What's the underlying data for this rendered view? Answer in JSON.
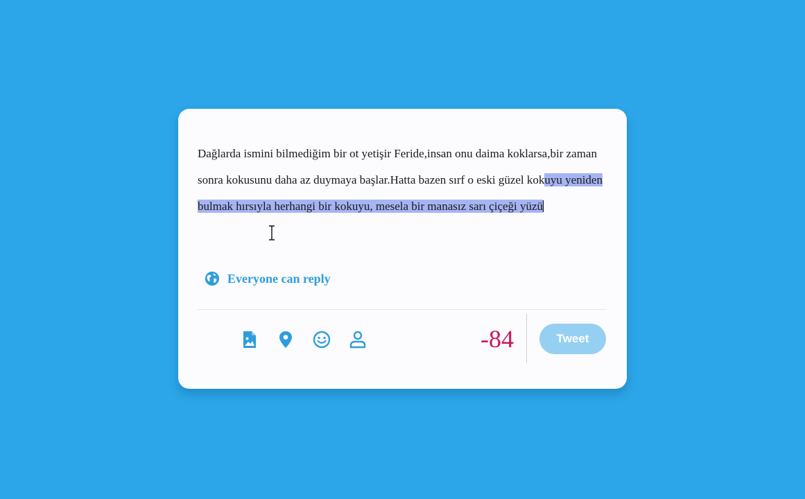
{
  "colors": {
    "background": "#2ca6e8",
    "card": "#fcfbfd",
    "accent": "#2d9edb",
    "selection": "#a6b4f4",
    "counter_negative": "#c8175f",
    "tweet_button_disabled": "#95d0f2"
  },
  "editor": {
    "text_before_selection": "Dağlarda ismini bilmediğim bir ot yetişir Feride,insan onu daima koklarsa,bir zaman sonra kokusunu daha az duymaya başlar.Hatta bazen sırf o eski güzel kok",
    "text_selected": "uyu yeniden bulmak hırsıyla herhangi bir kokuyu, mesela bir manasız sarı çiçeği yüzü"
  },
  "reply_setting": {
    "icon": "globe-icon",
    "label": "Everyone can reply"
  },
  "toolbar": {
    "icons": [
      "image-file-icon",
      "location-pin-icon",
      "smiley-icon",
      "person-icon"
    ]
  },
  "counter": {
    "value": "-84"
  },
  "tweet_button": {
    "label": "Tweet",
    "state": "disabled"
  }
}
